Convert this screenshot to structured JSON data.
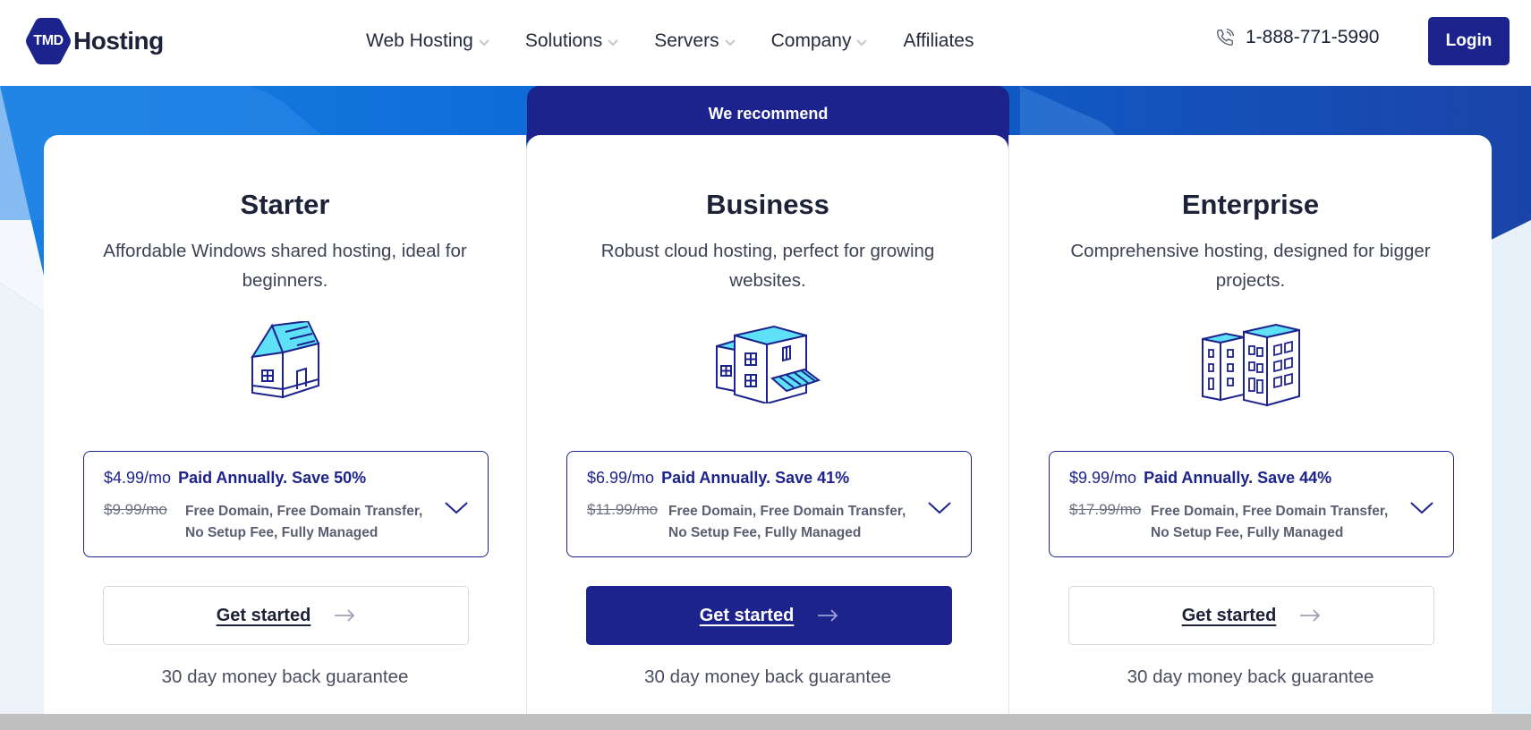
{
  "brand": {
    "badge": "TMD",
    "name": "Hosting",
    "color": "#1d238c"
  },
  "nav": {
    "items": [
      {
        "label": "Web Hosting",
        "has_dropdown": true
      },
      {
        "label": "Solutions",
        "has_dropdown": true
      },
      {
        "label": "Servers",
        "has_dropdown": true
      },
      {
        "label": "Company",
        "has_dropdown": true
      },
      {
        "label": "Affiliates",
        "has_dropdown": false
      }
    ],
    "phone": "1-888-771-5990",
    "phone_icon": "phone-icon",
    "login_label": "Login"
  },
  "recommend_label": "We recommend",
  "plans": [
    {
      "title": "Starter",
      "description": "Affordable Windows shared hosting, ideal for beginners.",
      "icon": "house-icon",
      "price": "$4.99/mo",
      "billing": "Paid Annually. Save 50%",
      "old_price": "$9.99/mo",
      "features": "Free Domain, Free Domain Transfer, No Setup Fee, Fully Managed",
      "cta": "Get started",
      "guarantee": "30 day money back guarantee",
      "recommended": false
    },
    {
      "title": "Business",
      "description": "Robust cloud hosting, perfect for growing websites.",
      "icon": "storefront-building-icon",
      "price": "$6.99/mo",
      "billing": "Paid Annually. Save 41%",
      "old_price": "$11.99/mo",
      "features": "Free Domain, Free Domain Transfer, No Setup Fee, Fully Managed",
      "cta": "Get started",
      "guarantee": "30 day money back guarantee",
      "recommended": true
    },
    {
      "title": "Enterprise",
      "description": "Comprehensive hosting, designed for bigger projects.",
      "icon": "office-buildings-icon",
      "price": "$9.99/mo",
      "billing": "Paid Annually. Save 44%",
      "old_price": "$17.99/mo",
      "features": "Free Domain, Free Domain Transfer, No Setup Fee, Fully Managed",
      "cta": "Get started",
      "guarantee": "30 day money back guarantee",
      "recommended": false
    }
  ],
  "colors": {
    "primary": "#1d238c",
    "accent_cyan": "#5ee0f7",
    "hero_blue": "#0b6bd9",
    "text_dark": "#1c2237"
  }
}
